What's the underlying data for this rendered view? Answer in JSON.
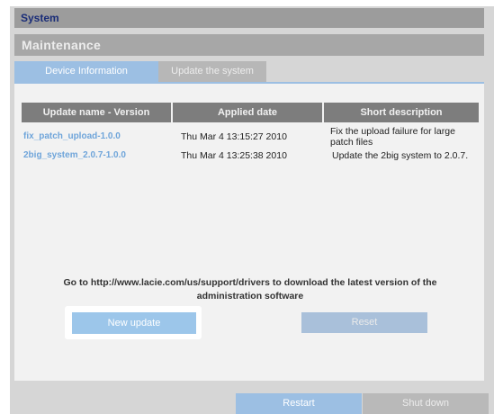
{
  "header": {
    "title": "System"
  },
  "section": {
    "title": "Maintenance"
  },
  "tabs": [
    {
      "label": "Device Information",
      "active": true
    },
    {
      "label": "Update the system",
      "active": false
    }
  ],
  "table": {
    "columns": [
      "Update name - Version",
      "Applied date",
      "Short description"
    ],
    "rows": [
      {
        "name": "fix_patch_upload-1.0.0",
        "date": "Thu Mar 4 13:15:27 2010",
        "description": "Fix the upload failure for large patch files"
      },
      {
        "name": "2big_system_2.0.7-1.0.0",
        "date": "Thu Mar 4 13:25:38 2010",
        "description": "Update the 2big system to 2.0.7."
      }
    ]
  },
  "info": {
    "line1": "Go to http://www.lacie.com/us/support/drivers to download the latest version of the",
    "line2": "administration software"
  },
  "buttons": {
    "new_update": "New update",
    "reset": "Reset",
    "restart": "Restart",
    "shutdown": "Shut down"
  },
  "colors": {
    "accent": "#9cbfe3",
    "header_text": "#1a2d78",
    "link": "#6fa5da"
  }
}
